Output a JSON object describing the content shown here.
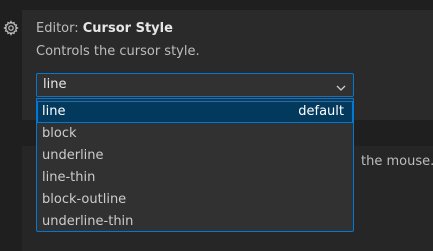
{
  "setting": {
    "category": "Editor: ",
    "name": "Cursor Style",
    "description": "Controls the cursor style.",
    "current_value": "line"
  },
  "dropdown": {
    "options": [
      {
        "label": "line",
        "badge": "default",
        "selected": true
      },
      {
        "label": "block",
        "badge": ""
      },
      {
        "label": "underline",
        "badge": ""
      },
      {
        "label": "line-thin",
        "badge": ""
      },
      {
        "label": "block-outline",
        "badge": ""
      },
      {
        "label": "underline-thin",
        "badge": ""
      }
    ]
  },
  "background_setting": {
    "partial_text": "the mouse."
  },
  "icons": {
    "gear": "gear-icon",
    "chevron": "chevron-down-icon"
  },
  "colors": {
    "accent": "#0078d4",
    "selected_bg": "#04395e",
    "card_bg": "#2a2a2a",
    "page_bg": "#1f1f1f"
  }
}
